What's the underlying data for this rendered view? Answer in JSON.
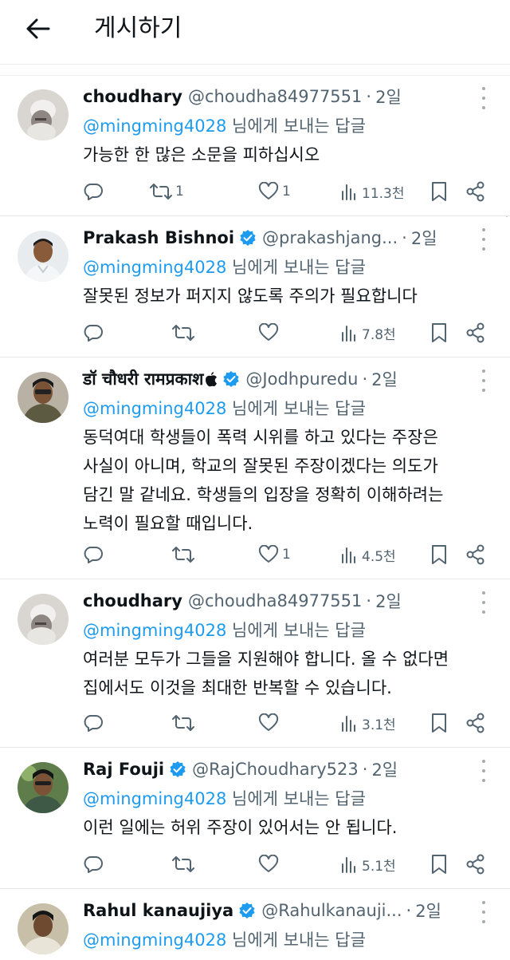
{
  "header": {
    "title": "게시하기"
  },
  "reply_prefix_suffix": "님에게 보내는 답글",
  "colors": {
    "link": "#1d9bf0",
    "muted": "#536471",
    "verified": "#1d9bf0"
  },
  "posts": [
    {
      "name": "choudhary",
      "verified": false,
      "handle": "@choudha84977551",
      "time": "2일",
      "mention": "@mingming4028",
      "lines": [
        "가능한 한 많은 소문을 피하십시오"
      ],
      "retweets": "1",
      "likes": "1",
      "views": "11.3천"
    },
    {
      "name": "Prakash Bishnoi",
      "verified": true,
      "handle": "@prakashjang...",
      "time": "2일",
      "mention": "@mingming4028",
      "lines": [
        "잘못된 정보가 퍼지지 않도록 주의가 필요합니다"
      ],
      "retweets": "",
      "likes": "",
      "views": "7.8천"
    },
    {
      "name": "डॉ चौधरी रामप्रकाश",
      "verified": true,
      "handle": "@Jodhpuredu",
      "time": "2일",
      "mention": "@mingming4028",
      "lines": [
        "동덕여대 학생들이 폭력 시위를 하고 있다는 주장은",
        "사실이 아니며, 학교의 잘못된 주장이겠다는 의도가",
        "담긴 말 같네요. 학생들의 입장을 정확히 이해하려는",
        "노력이 필요할 때입니다."
      ],
      "retweets": "",
      "likes": "1",
      "views": "4.5천"
    },
    {
      "name": "choudhary",
      "verified": false,
      "handle": "@choudha84977551",
      "time": "2일",
      "mention": "@mingming4028",
      "lines": [
        "여러분 모두가 그들을 지원해야 합니다. 올 수 없다면",
        "집에서도 이것을 최대한 반복할 수 있습니다."
      ],
      "retweets": "",
      "likes": "",
      "views": "3.1천"
    },
    {
      "name": "Raj Fouji",
      "verified": true,
      "handle": "@RajChoudhary523",
      "time": "2일",
      "mention": "@mingming4028",
      "lines": [
        "이런 일에는 허위 주장이 있어서는 안 됩니다."
      ],
      "retweets": "",
      "likes": "",
      "views": "5.1천"
    },
    {
      "name": "Rahul kanaujiya",
      "verified": true,
      "handle": "@Rahulkanauji...",
      "time": "2일",
      "mention": "@mingming4028",
      "lines": [],
      "retweets": "",
      "likes": "",
      "views": ""
    }
  ]
}
